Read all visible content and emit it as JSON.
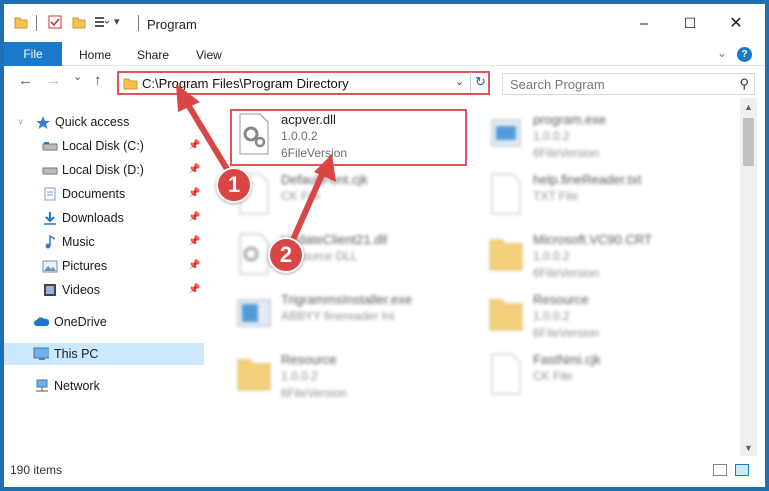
{
  "window": {
    "title": "Program",
    "controls": {
      "minimize": "–",
      "maximize": "☐",
      "close": "✕"
    }
  },
  "ribbon": {
    "tabs": [
      "File",
      "Home",
      "Share",
      "View"
    ],
    "expand_icon": "chevron-down-icon",
    "help_label": "?"
  },
  "nav": {
    "back": "←",
    "forward": "→",
    "recent": "⌄",
    "up": "↑",
    "address": "C:\\Program Files\\Program Directory",
    "dropdown": "⌄",
    "refresh": "↻",
    "search_placeholder": "Search Program",
    "search_glyph": "⚲"
  },
  "sidebar": {
    "items": [
      {
        "label": "Quick access",
        "icon": "star-icon",
        "pinned": false
      },
      {
        "label": "Local Disk (C:)",
        "icon": "drive-icon",
        "pinned": true
      },
      {
        "label": "Local Disk (D:)",
        "icon": "drive-icon",
        "pinned": true
      },
      {
        "label": "Documents",
        "icon": "documents-icon",
        "pinned": true
      },
      {
        "label": "Downloads",
        "icon": "downloads-icon",
        "pinned": true
      },
      {
        "label": "Music",
        "icon": "music-icon",
        "pinned": true
      },
      {
        "label": "Pictures",
        "icon": "pictures-icon",
        "pinned": true
      },
      {
        "label": "Videos",
        "icon": "videos-icon",
        "pinned": true
      },
      {
        "label": "OneDrive",
        "icon": "cloud-icon",
        "pinned": false
      },
      {
        "label": "This PC",
        "icon": "computer-icon",
        "pinned": false,
        "selected": true
      },
      {
        "label": "Network",
        "icon": "network-icon",
        "pinned": false
      }
    ],
    "pin_glyph": "📌"
  },
  "files": [
    {
      "name": "acpver.dll",
      "line2": "1.0.0.2",
      "line3": "6FileVersion",
      "icon": "dll-gear-icon",
      "highlighted": true
    },
    {
      "name": "program.exe",
      "line2": "1.0.0.2",
      "line3": "6FileVersion",
      "icon": "exe-icon"
    },
    {
      "name": "DefaultFont.cjk",
      "line2": "CK File",
      "line3": "",
      "icon": "file-icon"
    },
    {
      "name": "help.fineReader.txt",
      "line2": "TXT File",
      "line3": "",
      "icon": "file-icon"
    },
    {
      "name": "UpdateClient21.dll",
      "line2": "Resource DLL",
      "line3": "",
      "icon": "dll-gear-icon"
    },
    {
      "name": "Microsoft.VC90.CRT",
      "line2": "1.0.0.2",
      "line3": "6FileVersion",
      "icon": "folder-icon"
    },
    {
      "name": "TrigrammsInstaller.exe",
      "line2": "ABBYY finereader Ini",
      "line3": "",
      "icon": "exe-icon"
    },
    {
      "name": "Resource",
      "line2": "1.0.0.2",
      "line3": "6FileVersion",
      "icon": "folder-icon"
    },
    {
      "name": "Resource",
      "line2": "1.0.0.2",
      "line3": "6FileVersion",
      "icon": "folder-icon"
    },
    {
      "name": "FastNmi.cjk",
      "line2": "CK File",
      "line3": "",
      "icon": "file-icon"
    }
  ],
  "status": {
    "item_count": "190 items"
  },
  "annotations": {
    "step1": "1",
    "step2": "2"
  },
  "colors": {
    "accent": "#1979ca",
    "annotation": "#d94646",
    "selection": "#cce8ff"
  }
}
